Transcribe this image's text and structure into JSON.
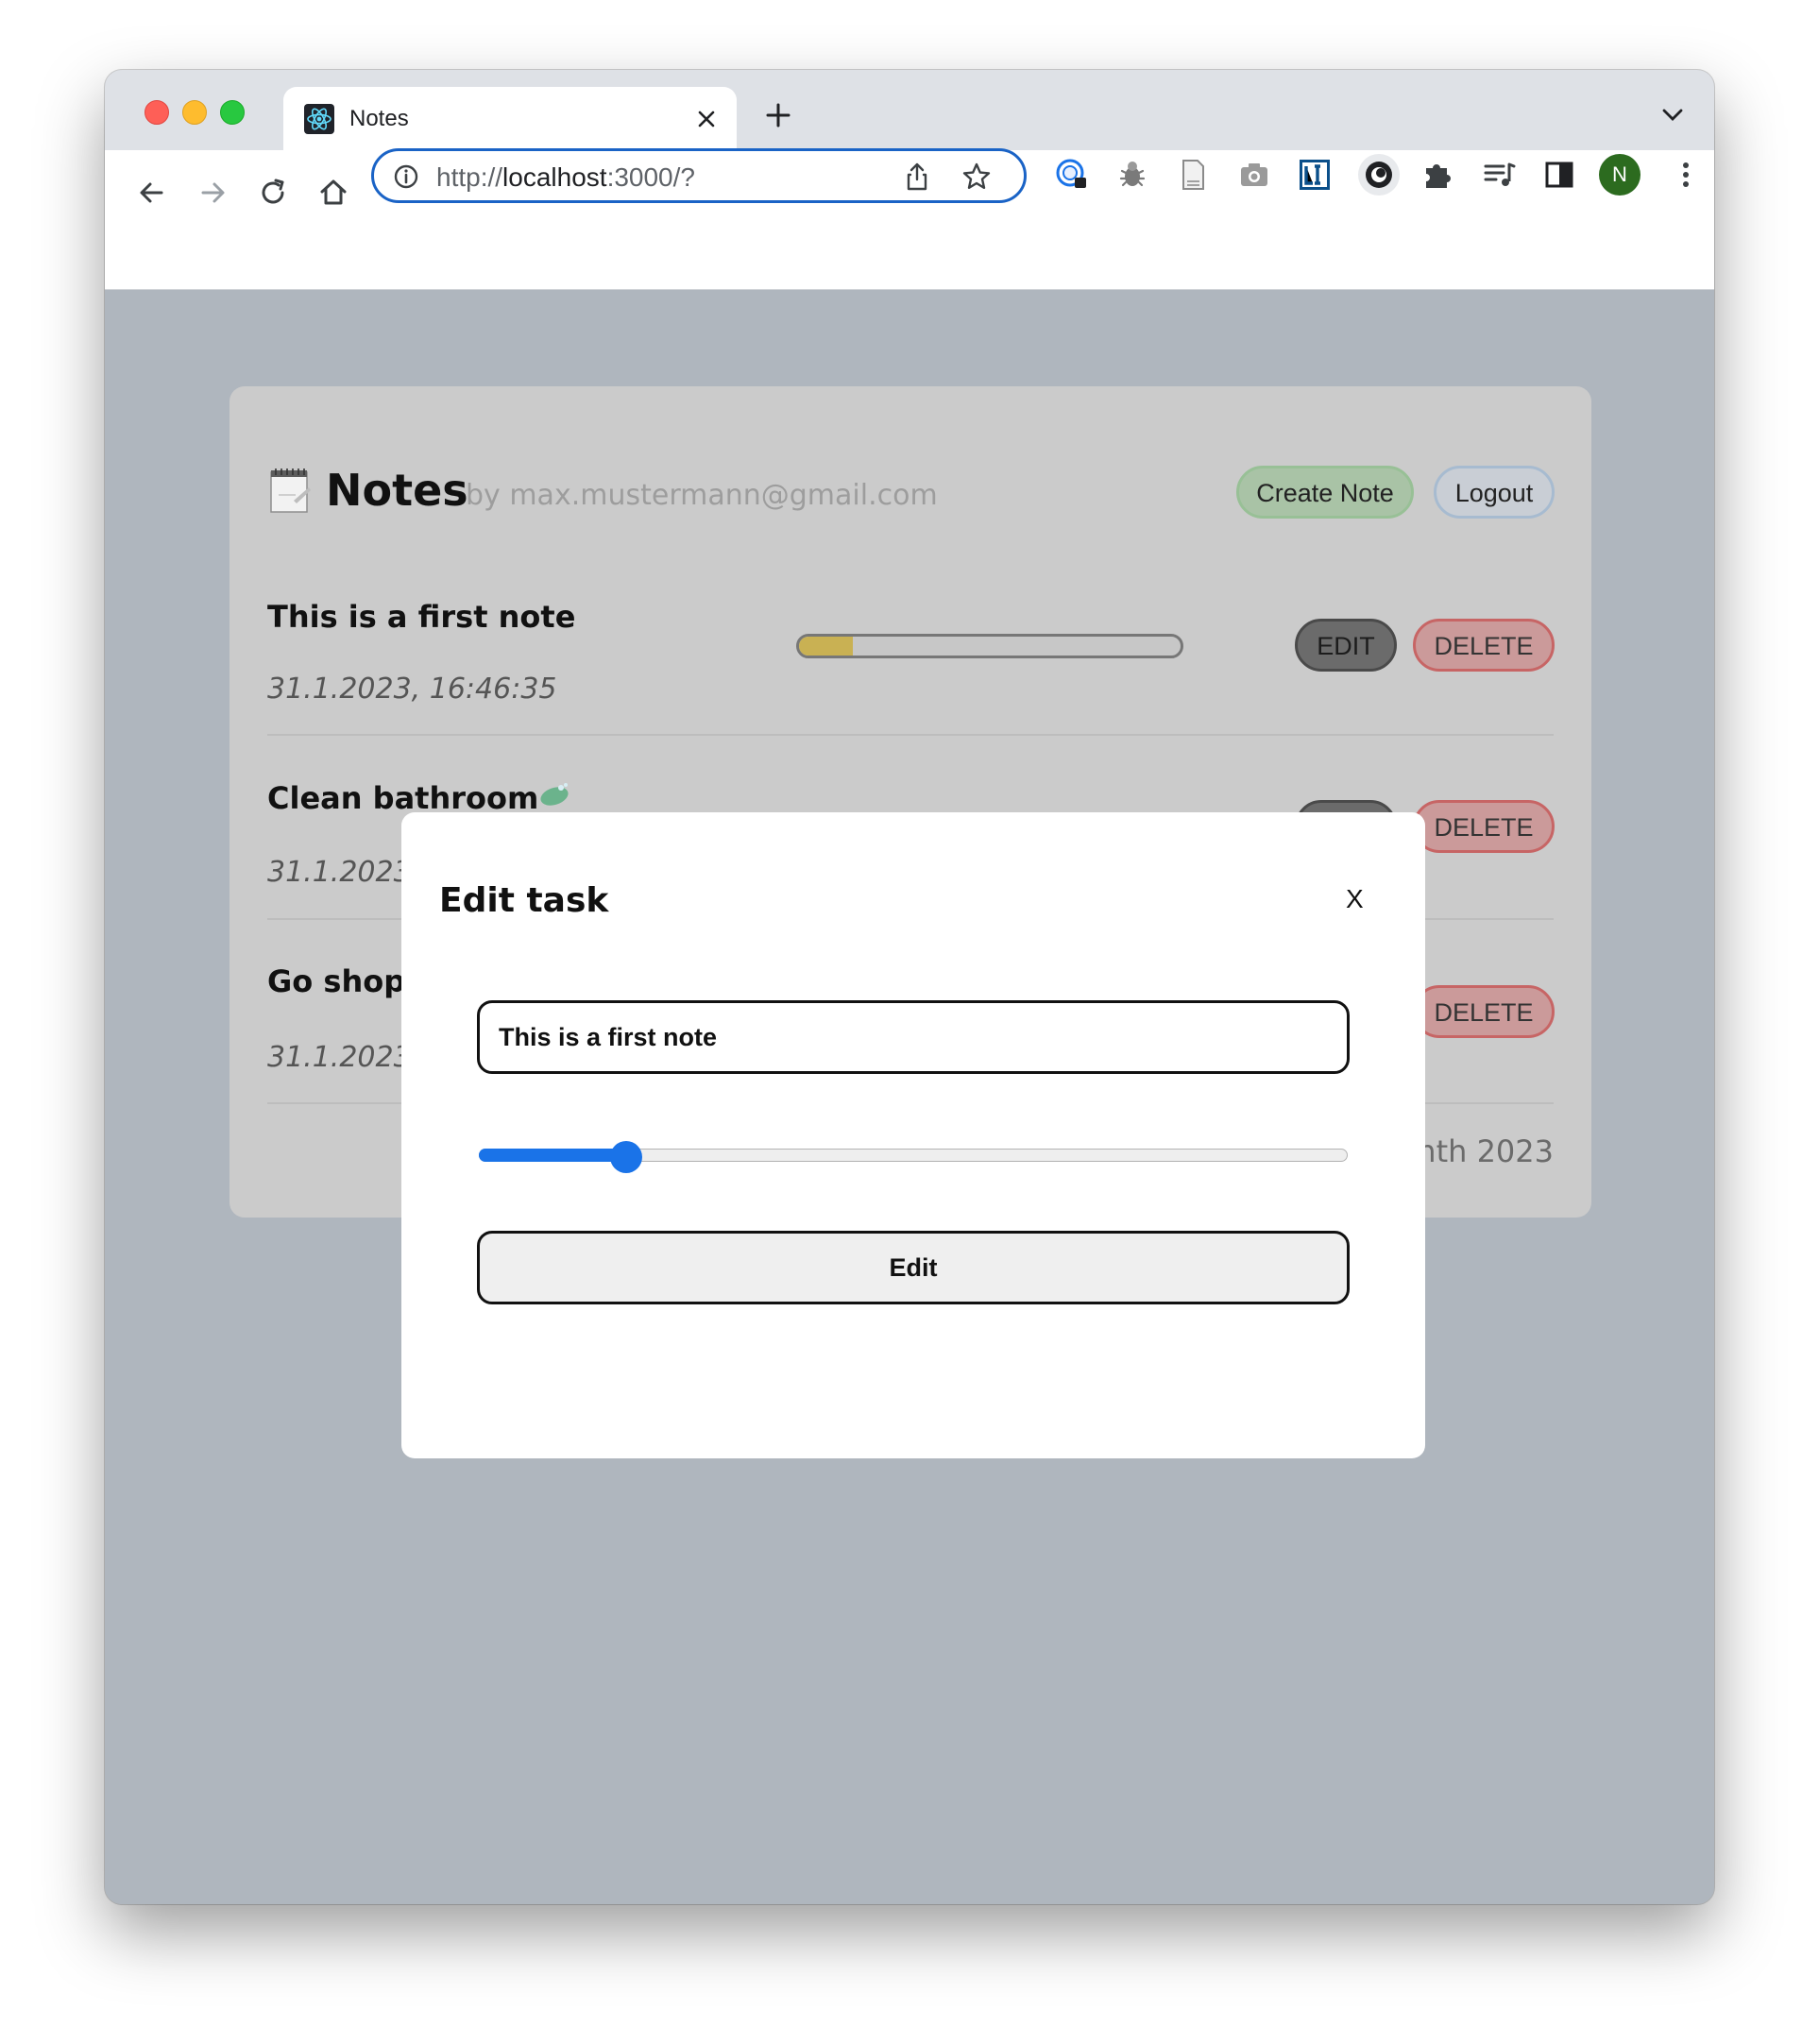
{
  "browser": {
    "tab_title": "Notes",
    "url_prefix": "http://",
    "url_host": "localhost",
    "url_rest": ":3000/?",
    "profile_initial": "N",
    "colors": {
      "accent": "#1a63c6",
      "profile": "#2c6b1f"
    }
  },
  "app": {
    "title": "Notes",
    "user": "by max.mustermann@gmail.com",
    "create_label": "Create Note",
    "logout_label": "Logout",
    "edit_label": "EDIT",
    "delete_label": "DELETE",
    "footer": "Ninth 2023",
    "progress_color": "#c9b153"
  },
  "notes": [
    {
      "title": "This is a first note",
      "date": "31.1.2023, 16:46:35",
      "progress": 0.14
    },
    {
      "title": "Clean bathroom",
      "date": "31.1.2023,"
    },
    {
      "title": "Go shopping",
      "date": "31.1.2023,"
    }
  ],
  "modal": {
    "title": "Edit task",
    "close_label": "X",
    "input_value": "This is a first note",
    "slider_value": 0.17,
    "submit_label": "Edit"
  }
}
